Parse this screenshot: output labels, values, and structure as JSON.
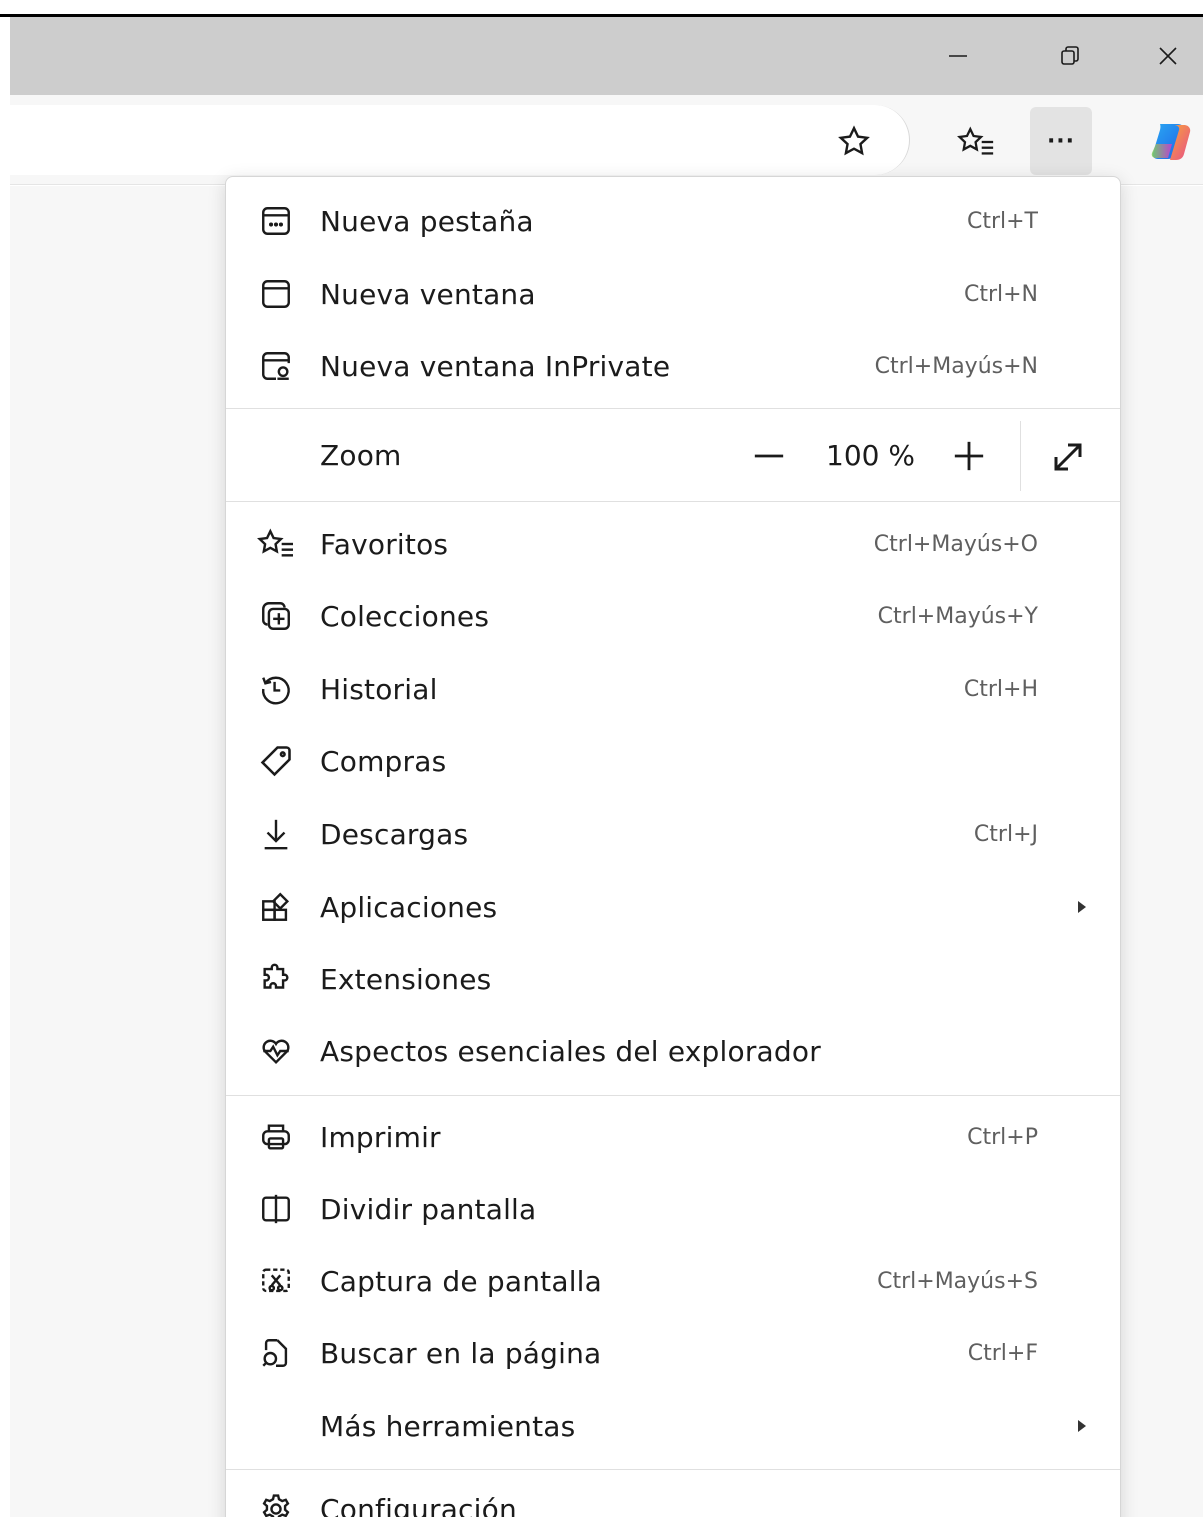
{
  "window": {
    "minimize_icon": "minimize-icon",
    "restore_icon": "restore-icon",
    "close_icon": "close-icon"
  },
  "toolbar": {
    "more_label": "···",
    "favorite_icon": "star-icon",
    "favorites_icon": "favorites-list-icon",
    "copilot_icon": "copilot-icon"
  },
  "menu": {
    "items": [
      {
        "label": "Nueva pestaña",
        "shortcut": "Ctrl+T",
        "icon": "new-tab-icon"
      },
      {
        "label": "Nueva ventana",
        "shortcut": "Ctrl+N",
        "icon": "new-window-icon"
      },
      {
        "label": "Nueva ventana InPrivate",
        "shortcut": "Ctrl+Mayús+N",
        "icon": "inprivate-icon"
      }
    ],
    "zoom": {
      "label": "Zoom",
      "value": "100 %"
    },
    "items2": [
      {
        "label": "Favoritos",
        "shortcut": "Ctrl+Mayús+O",
        "icon": "favorites-icon"
      },
      {
        "label": "Colecciones",
        "shortcut": "Ctrl+Mayús+Y",
        "icon": "collections-icon"
      },
      {
        "label": "Historial",
        "shortcut": "Ctrl+H",
        "icon": "history-icon"
      },
      {
        "label": "Compras",
        "shortcut": "",
        "icon": "shopping-tag-icon"
      },
      {
        "label": "Descargas",
        "shortcut": "Ctrl+J",
        "icon": "download-icon"
      },
      {
        "label": "Aplicaciones",
        "shortcut": "",
        "icon": "apps-icon"
      },
      {
        "label": "Extensiones",
        "shortcut": "",
        "icon": "extensions-icon"
      },
      {
        "label": "Aspectos esenciales del explorador",
        "shortcut": "",
        "icon": "heart-pulse-icon"
      }
    ],
    "items3": [
      {
        "label": "Imprimir",
        "shortcut": "Ctrl+P",
        "icon": "print-icon"
      },
      {
        "label": "Dividir pantalla",
        "shortcut": "",
        "icon": "split-screen-icon"
      },
      {
        "label": "Captura de pantalla",
        "shortcut": "Ctrl+Mayús+S",
        "icon": "screenshot-icon"
      },
      {
        "label": "Buscar en la página",
        "shortcut": "Ctrl+F",
        "icon": "find-in-page-icon"
      },
      {
        "label": "Más herramientas",
        "shortcut": "",
        "icon": ""
      }
    ],
    "items4": [
      {
        "label": "Configuración",
        "shortcut": "",
        "icon": "settings-icon"
      }
    ]
  }
}
